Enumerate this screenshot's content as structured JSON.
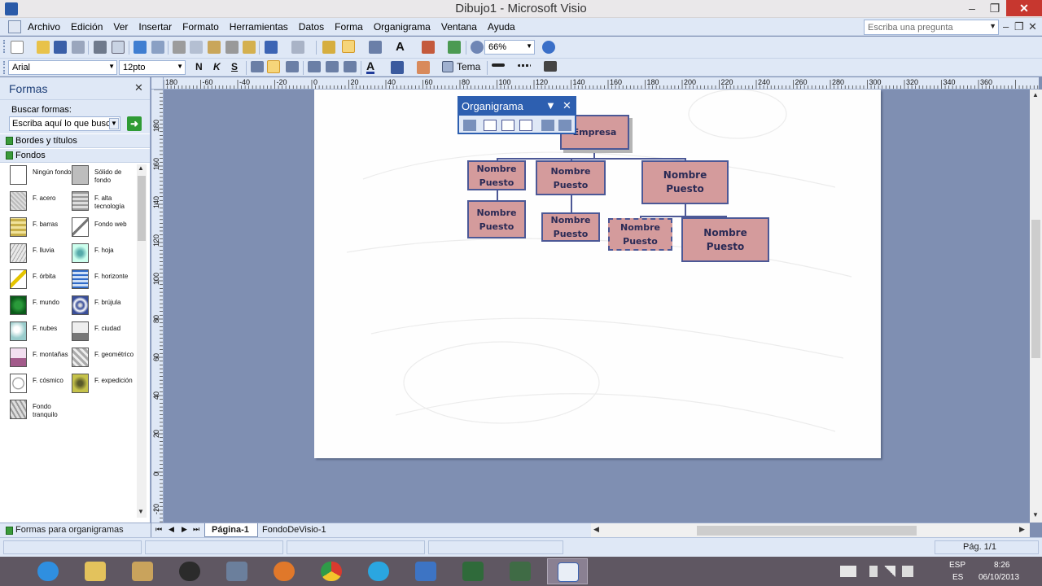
{
  "window": {
    "title": "Dibujo1 - Microsoft Visio",
    "min": "‒",
    "max": "❐",
    "close": "✕"
  },
  "menu": {
    "items": [
      "Archivo",
      "Edición",
      "Ver",
      "Insertar",
      "Formato",
      "Herramientas",
      "Datos",
      "Forma",
      "Organigrama",
      "Ventana",
      "Ayuda"
    ],
    "help_placeholder": "Escriba una pregunta"
  },
  "toolbar": {
    "zoom": "66%",
    "font": "Arial",
    "font_size": "12pto",
    "bold": "N",
    "italic": "K",
    "underline": "S",
    "theme": "Tema"
  },
  "shapes_pane": {
    "title": "Formas",
    "close": "✕",
    "search_label": "Buscar formas:",
    "search_value": "Escriba aquí lo que busca",
    "go": "➜",
    "stencils": [
      "Bordes y títulos",
      "Fondos"
    ],
    "items": [
      {
        "label": "Ningún fondo",
        "icon": "ningun-fondo-icon"
      },
      {
        "label": "Sólido de fondo",
        "icon": "solido-icon"
      },
      {
        "label": "F. acero",
        "icon": "acero-icon"
      },
      {
        "label": "F. alta tecnología",
        "icon": "alta-tecnologia-icon"
      },
      {
        "label": "F. barras",
        "icon": "barras-icon"
      },
      {
        "label": "Fondo web",
        "icon": "web-icon"
      },
      {
        "label": "F. lluvia",
        "icon": "lluvia-icon"
      },
      {
        "label": "F. hoja",
        "icon": "hoja-icon"
      },
      {
        "label": "F. órbita",
        "icon": "orbita-icon"
      },
      {
        "label": "F. horizonte",
        "icon": "horizonte-icon"
      },
      {
        "label": "F. mundo",
        "icon": "mundo-icon"
      },
      {
        "label": "F. brújula",
        "icon": "brujula-icon"
      },
      {
        "label": "F. nubes",
        "icon": "nubes-icon"
      },
      {
        "label": "F. ciudad",
        "icon": "ciudad-icon"
      },
      {
        "label": "F. montañas",
        "icon": "montanas-icon"
      },
      {
        "label": "F. geométrico",
        "icon": "geometrico-icon"
      },
      {
        "label": "F. cósmico",
        "icon": "cosmico-icon"
      },
      {
        "label": "F. expedición",
        "icon": "expedicion-icon"
      },
      {
        "label": "Fondo tranquilo",
        "icon": "tranquilo-icon"
      }
    ],
    "footer": "Formas para organigramas"
  },
  "rulers": {
    "h": [
      "180",
      "-60",
      "-40",
      "-20",
      "0",
      "20",
      "40",
      "60",
      "80",
      "100",
      "120",
      "140",
      "160",
      "180",
      "200",
      "220",
      "240",
      "260",
      "280",
      "300",
      "320",
      "340",
      "360"
    ],
    "v": [
      "180",
      "160",
      "140",
      "120",
      "100",
      "80",
      "60",
      "40",
      "20",
      "0",
      "-20"
    ]
  },
  "org_chart": {
    "root": "Empresa",
    "nodes": [
      "Nombre Puesto",
      "Nombre Puesto",
      "Nombre Puesto",
      "Nombre Puesto",
      "Nombre Puesto",
      "Nombre Puesto",
      "Nombre Puesto"
    ]
  },
  "org_toolbar": {
    "title": "Organigrama",
    "menu_arrow": "▼",
    "close": "✕"
  },
  "tabs": {
    "page1": "Página-1",
    "fondo": "FondoDeVisio-1"
  },
  "status": {
    "page": "Pág. 1/1"
  },
  "tray": {
    "lang_top": "ESP",
    "lang_bottom": "ES",
    "time": "8:26",
    "date": "06/10/2013"
  }
}
